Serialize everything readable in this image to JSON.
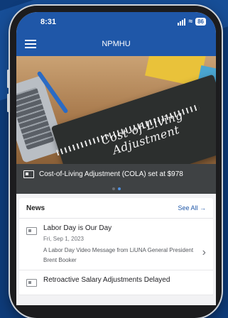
{
  "status": {
    "time": "8:31",
    "battery": "86"
  },
  "nav": {
    "title": "NPMHU"
  },
  "hero": {
    "image_text_line1": "Cost-of-Living",
    "image_text_line2": "Adjustment",
    "caption": "Cost-of-Living Adjustment (COLA) set at $978",
    "carousel_active_index": 2,
    "carousel_count": 2
  },
  "news": {
    "heading": "News",
    "see_all": "See All →",
    "items": [
      {
        "title": "Labor Day is Our Day",
        "date": "Fri, Sep 1, 2023",
        "description": "A Labor Day Video Message from LiUNA General President Brent Booker"
      },
      {
        "title": "Retroactive Salary Adjustments Delayed"
      }
    ]
  },
  "colors": {
    "primary": "#1f57a8",
    "background": "#0e3b79",
    "caption_bg": "#3f4244"
  }
}
